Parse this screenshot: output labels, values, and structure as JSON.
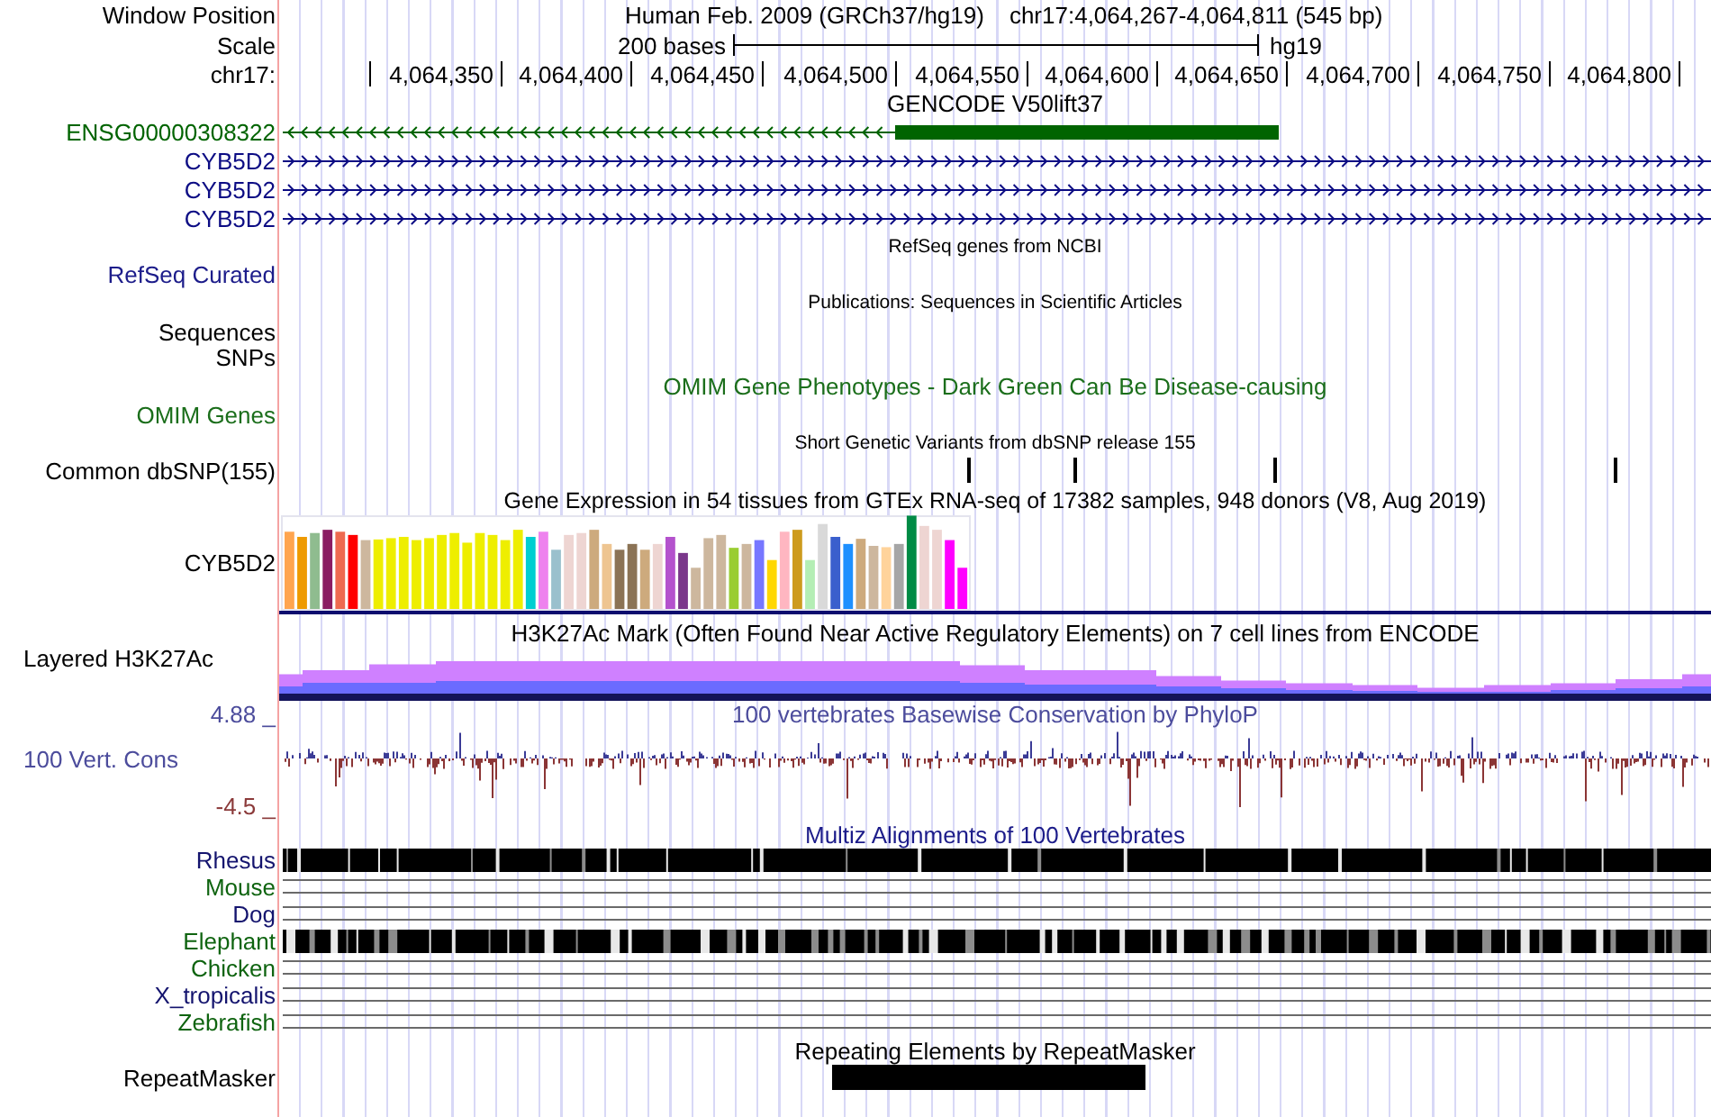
{
  "header": {
    "window_position_label": "Window Position",
    "assembly": "Human Feb. 2009 (GRCh37/hg19)",
    "position": "chr17:4,064,267-4,064,811 (545 bp)",
    "scale_label": "Scale",
    "scale_text": "200 bases",
    "scale_db": "hg19",
    "chrom_label": "chr17:"
  },
  "ruler_labels": [
    "4,064,350",
    "4,064,400",
    "4,064,450",
    "4,064,500",
    "4,064,550",
    "4,064,600",
    "4,064,650",
    "4,064,700",
    "4,064,750",
    "4,064,800"
  ],
  "gencode": {
    "title": "GENCODE V50lift37",
    "genes": [
      {
        "name": "ENSG00000308322",
        "color": "#006400"
      },
      {
        "name": "CYB5D2",
        "color": "#0c0c84"
      },
      {
        "name": "CYB5D2",
        "color": "#0c0c84"
      },
      {
        "name": "CYB5D2",
        "color": "#0c0c84"
      }
    ]
  },
  "refseq": {
    "title": "RefSeq genes from NCBI",
    "label": "RefSeq Curated"
  },
  "publications": {
    "title": "Publications: Sequences in Scientific Articles",
    "labels": [
      "Sequences",
      "SNPs"
    ]
  },
  "omim": {
    "title": "OMIM Gene Phenotypes - Dark Green Can Be Disease-causing",
    "label": "OMIM Genes"
  },
  "dbsnp": {
    "title": "Short Genetic Variants from dbSNP release 155",
    "label": "Common dbSNP(155)"
  },
  "gtex": {
    "title": "Gene Expression in 54 tissues from GTEx RNA-seq of 17382 samples, 948 donors (V8, Aug 2019)",
    "label": "CYB5D2"
  },
  "h3k27ac": {
    "title": "H3K27Ac Mark (Often Found Near Active Regulatory Elements) on 7 cell lines from ENCODE",
    "label": "Layered H3K27Ac"
  },
  "phylop": {
    "title": "100 vertebrates Basewise Conservation by PhyloP",
    "label": "100 Vert. Cons",
    "max": "4.88 _",
    "min": "-4.5 _"
  },
  "multiz": {
    "title": "Multiz Alignments of 100 Vertebrates",
    "species": [
      {
        "name": "Rhesus",
        "color": "#14146e",
        "kind": "blocks"
      },
      {
        "name": "Mouse",
        "color": "#0f6410",
        "kind": "lines"
      },
      {
        "name": "Dog",
        "color": "#14146e",
        "kind": "lines"
      },
      {
        "name": "Elephant",
        "color": "#0f6410",
        "kind": "blocks"
      },
      {
        "name": "Chicken",
        "color": "#0f6410",
        "kind": "lines"
      },
      {
        "name": "X_tropicalis",
        "color": "#14146e",
        "kind": "lines"
      },
      {
        "name": "Zebrafish",
        "color": "#0f6410",
        "kind": "lines"
      }
    ]
  },
  "repeatmasker": {
    "title": "Repeating Elements by RepeatMasker",
    "label": "RepeatMasker"
  }
}
